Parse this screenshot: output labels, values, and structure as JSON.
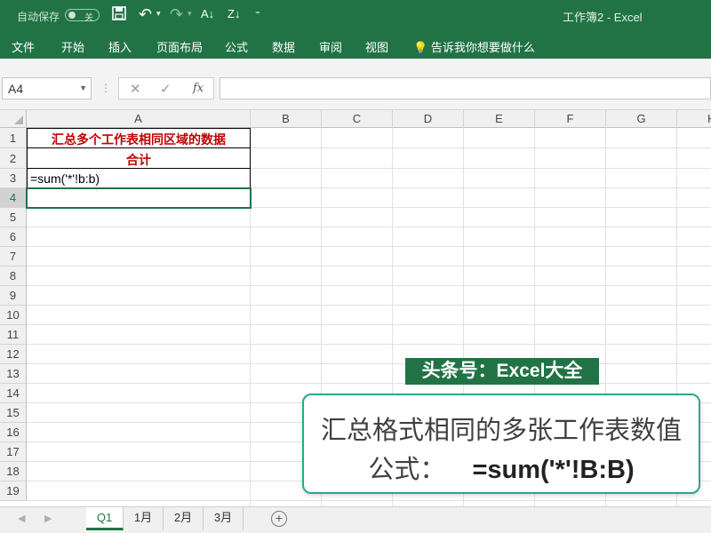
{
  "titlebar": {
    "autosave_label": "自动保存",
    "toggle_state": "关",
    "title": "工作簿2  -  Excel"
  },
  "ribbon": {
    "tabs": [
      "文件",
      "开始",
      "插入",
      "页面布局",
      "公式",
      "数据",
      "审阅",
      "视图"
    ],
    "tell_me": "告诉我你想要做什么"
  },
  "formula_bar": {
    "name_box": "A4",
    "fx": "fx",
    "formula": ""
  },
  "sheet": {
    "columns": [
      "A",
      "B",
      "C",
      "D",
      "E",
      "F",
      "G",
      "H"
    ],
    "rows": [
      "1",
      "2",
      "3",
      "4",
      "5",
      "6",
      "7",
      "8",
      "9",
      "10",
      "11",
      "12",
      "13",
      "14",
      "15",
      "16",
      "17",
      "18",
      "19"
    ],
    "cells": {
      "A1": "汇总多个工作表相同区域的数据",
      "A2": "合计",
      "A3": "=sum('*'!b:b)"
    }
  },
  "overlay": {
    "brand": "头条号：Excel大全",
    "note_line1": "汇总格式相同的多张工作表数值",
    "note_line2_prefix": "公式：",
    "note_line2_formula": "=sum('*'!B:B)"
  },
  "sheet_tabs": {
    "tabs": [
      "Q1",
      "1月",
      "2月",
      "3月"
    ],
    "active": "Q1"
  },
  "colors": {
    "excel_green": "#217346",
    "header_red": "#c00000",
    "note_border": "#2aa88a"
  }
}
